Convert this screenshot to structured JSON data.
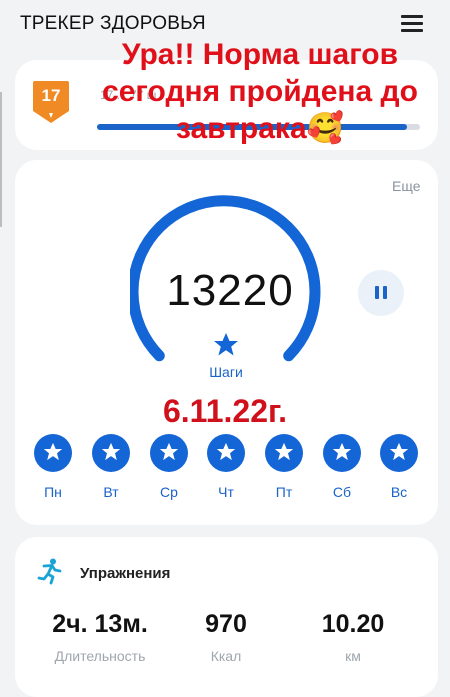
{
  "header": {
    "title": "ТРЕКЕР ЗДОРОВЬЯ",
    "menu_icon": "hamburger-menu-icon"
  },
  "level": {
    "badge_number": "17",
    "badge_color": "#f08a24",
    "progress": 0.96,
    "faint_text": "17 ... 77 ш",
    "progress_color": "#1a63c9"
  },
  "overlay_caption": {
    "line1": "Ура!! Норма шагов",
    "line2": "сегодня пройдена до",
    "line3": "завтрака",
    "emoji": "🥰",
    "color": "#e0101a"
  },
  "steps_card": {
    "more_link": "Еще",
    "step_count": "13220",
    "steps_label": "Шаги",
    "goal_progress": 1.0,
    "accent_color": "#1466d6",
    "pause_icon": "pause-icon"
  },
  "date_caption": "6.11.22г.",
  "week": {
    "days": [
      "Пн",
      "Вт",
      "Ср",
      "Чт",
      "Пт",
      "Сб",
      "Вс"
    ],
    "icon": "star-icon"
  },
  "exercise": {
    "title": "Упражнения",
    "icon": "running-person-icon",
    "stats": [
      {
        "value": "2ч. 13м.",
        "label": "Длительность"
      },
      {
        "value": "970",
        "label": "Ккал"
      },
      {
        "value": "10.20",
        "label": "км"
      }
    ]
  }
}
